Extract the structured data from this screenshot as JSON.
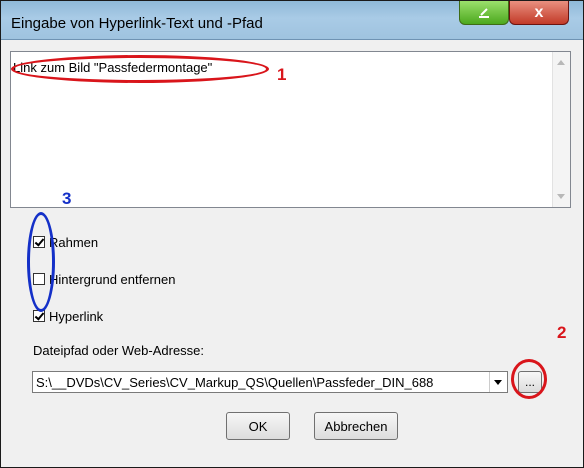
{
  "window": {
    "title": "Eingabe von Hyperlink-Text und -Pfad",
    "minimize_glyph": "−",
    "close_glyph": "x"
  },
  "textarea": {
    "value": "Link zum Bild \"Passfedermontage\""
  },
  "options": {
    "frame_label": "Rahmen",
    "frame_checked": true,
    "remove_background_label": "Hintergrund entfernen",
    "remove_background_checked": false,
    "hyperlink_label": "Hyperlink",
    "hyperlink_checked": true
  },
  "path": {
    "label": "Dateipfad oder Web-Adresse:",
    "value": "S:\\__DVDs\\CV_Series\\CV_Markup_QS\\Quellen\\Passfeder_DIN_688",
    "browse_label": "..."
  },
  "buttons": {
    "ok_label": "OK",
    "cancel_label": "Abbrechen"
  },
  "annotations": {
    "num1": "1",
    "num2": "2",
    "num3": "3",
    "red_color": "#d9151b",
    "blue_color": "#1430c8"
  }
}
